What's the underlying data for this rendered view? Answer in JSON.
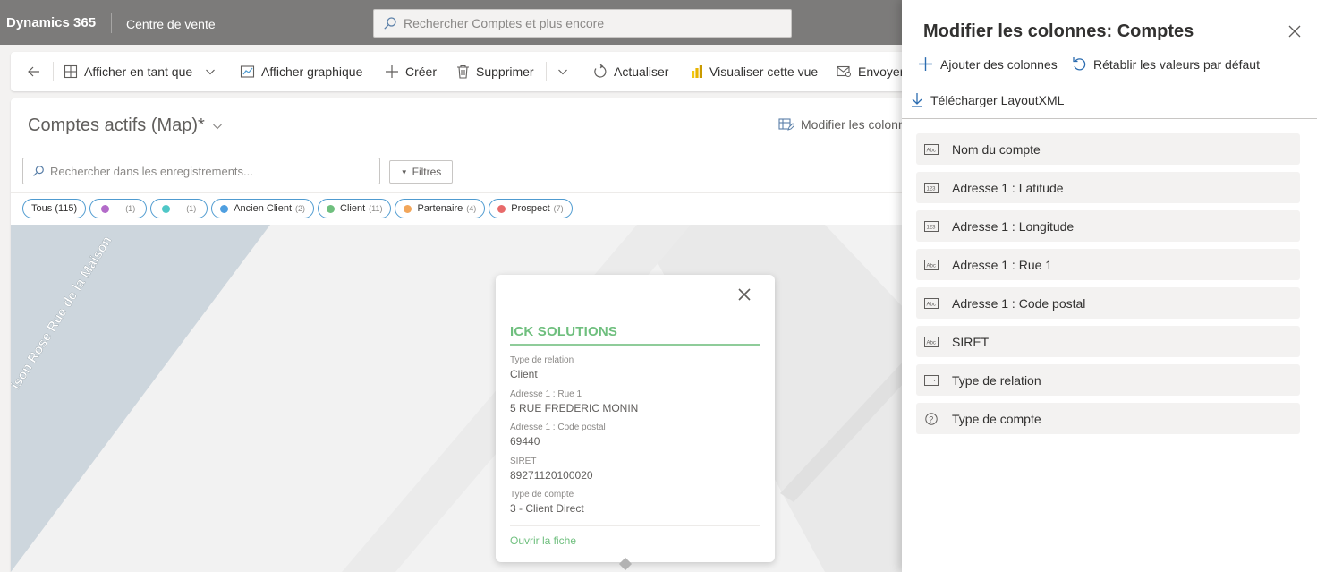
{
  "topbar": {
    "brand": "Dynamics 365",
    "app_name": "Centre de vente",
    "search_placeholder": "Rechercher Comptes et plus encore"
  },
  "commandbar": {
    "show_as": "Afficher en tant que",
    "show_chart": "Afficher graphique",
    "create": "Créer",
    "delete": "Supprimer",
    "refresh": "Actualiser",
    "visualize": "Visualiser cette vue",
    "send": "Envoyer"
  },
  "view": {
    "title": "Comptes actifs (Map)*",
    "edit_columns": "Modifier les colonnes",
    "search_placeholder": "Rechercher dans les enregistrements...",
    "filters": "Filtres"
  },
  "chips": [
    {
      "label": "Tous",
      "count": "(115)",
      "color": ""
    },
    {
      "label": "",
      "count": "(1)",
      "color": "#b36bc9"
    },
    {
      "label": "",
      "count": "(1)",
      "color": "#4fc7c7"
    },
    {
      "label": "Ancien Client",
      "count": "(2)",
      "color": "#4f9fe0"
    },
    {
      "label": "Client",
      "count": "(11)",
      "color": "#6fbf7e"
    },
    {
      "label": "Partenaire",
      "count": "(4)",
      "color": "#f2a65a"
    },
    {
      "label": "Prospect",
      "count": "(7)",
      "color": "#e86a6a"
    }
  ],
  "map": {
    "street_label": "ison Rose Rue de la Maison"
  },
  "popup": {
    "title": "ICK SOLUTIONS",
    "fields": [
      {
        "label": "Type de relation",
        "value": "Client"
      },
      {
        "label": "Adresse 1 : Rue 1",
        "value": "5 RUE FREDERIC MONIN"
      },
      {
        "label": "Adresse 1 : Code postal",
        "value": "69440"
      },
      {
        "label": "SIRET",
        "value": "89271120100020"
      },
      {
        "label": "Type de compte",
        "value": "3 - Client Direct"
      }
    ],
    "link": "Ouvrir la fiche"
  },
  "panel": {
    "title": "Modifier les colonnes: Comptes",
    "add_columns": "Ajouter des colonnes",
    "reset_defaults": "Rétablir les valeurs par défaut",
    "download_layout": "Télécharger LayoutXML",
    "columns": [
      {
        "label": "Nom du compte",
        "icon": "text-field-icon"
      },
      {
        "label": "Adresse 1 : Latitude",
        "icon": "number-field-icon"
      },
      {
        "label": "Adresse 1 : Longitude",
        "icon": "number-field-icon"
      },
      {
        "label": "Adresse 1 : Rue 1",
        "icon": "text-field-icon"
      },
      {
        "label": "Adresse 1 : Code postal",
        "icon": "text-field-icon"
      },
      {
        "label": "SIRET",
        "icon": "text-field-icon"
      },
      {
        "label": "Type de relation",
        "icon": "option-set-icon"
      },
      {
        "label": "Type de compte",
        "icon": "question-icon"
      }
    ]
  },
  "colors": {
    "topbar": "#7c7b7a",
    "accent_green": "#6fbf7e",
    "chip_border": "#4f9bd0"
  }
}
